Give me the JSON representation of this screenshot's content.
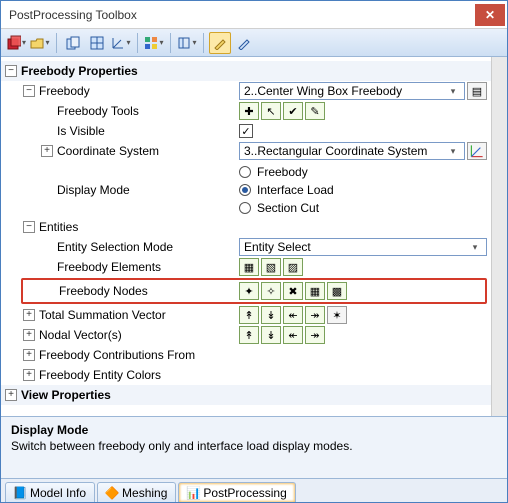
{
  "window": {
    "title": "PostProcessing Toolbox"
  },
  "groups": {
    "freebody_props": "Freebody Properties",
    "view_props": "View Properties"
  },
  "freebody": {
    "label": "Freebody",
    "value": "2..Center Wing Box Freebody",
    "tools_label": "Freebody Tools",
    "is_visible_label": "Is Visible",
    "coord_label": "Coordinate System",
    "coord_value": "3..Rectangular Coordinate System",
    "display_mode_label": "Display Mode",
    "display_modes": {
      "a": "Freebody",
      "b": "Interface Load",
      "c": "Section Cut"
    }
  },
  "entities": {
    "label": "Entities",
    "selection_mode_label": "Entity Selection Mode",
    "selection_mode_value": "Entity Select",
    "elements_label": "Freebody Elements",
    "nodes_label": "Freebody Nodes"
  },
  "vectors": {
    "tsv_label": "Total Summation Vector",
    "nodal_label": "Nodal Vector(s)",
    "contrib_label": "Freebody Contributions From",
    "colors_label": "Freebody Entity Colors"
  },
  "description": {
    "title": "Display Mode",
    "body": "Switch between freebody only and interface load display modes."
  },
  "tabs": {
    "a": "Model Info",
    "b": "Meshing",
    "c": "PostProcessing"
  }
}
